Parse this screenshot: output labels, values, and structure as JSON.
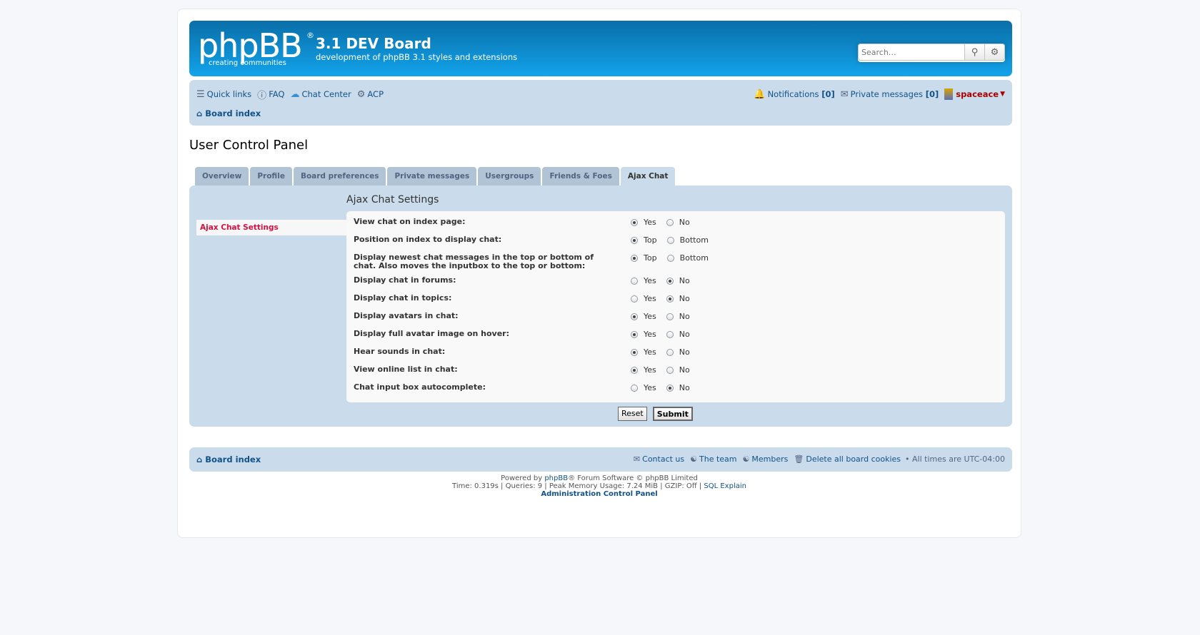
{
  "header": {
    "logo_text": "phpBB",
    "logo_reg": "®",
    "logo_sub": "creating   communities",
    "site_title": "3.1 DEV Board",
    "site_desc": "development of phpBB 3.1 styles and extensions",
    "search_placeholder": "Search…"
  },
  "nav": {
    "quick_links": "Quick links",
    "faq": "FAQ",
    "chat_center": "Chat Center",
    "acp": "ACP",
    "notifications": "Notifications",
    "notifications_count": "[0]",
    "private_messages": "Private messages",
    "pm_count": "[0]",
    "username": "spaceace",
    "breadcrumb": "Board index"
  },
  "page_title": "User Control Panel",
  "tabs": [
    {
      "label": "Overview"
    },
    {
      "label": "Profile"
    },
    {
      "label": "Board preferences"
    },
    {
      "label": "Private messages"
    },
    {
      "label": "Usergroups"
    },
    {
      "label": "Friends & Foes"
    },
    {
      "label": "Ajax Chat"
    }
  ],
  "sidenav": {
    "item": "Ajax Chat Settings"
  },
  "content": {
    "heading": "Ajax Chat Settings",
    "rows": [
      {
        "label": "View chat on index page:",
        "opt1": "Yes",
        "opt2": "No",
        "selected": 1
      },
      {
        "label": "Position on index to display chat:",
        "opt1": "Top",
        "opt2": "Bottom",
        "selected": 1
      },
      {
        "label": "Display newest chat messages in the top or bottom of chat. Also moves the inputbox to the top or bottom:",
        "opt1": "Top",
        "opt2": "Bottom",
        "selected": 1
      },
      {
        "label": "Display chat in forums:",
        "opt1": "Yes",
        "opt2": "No",
        "selected": 2
      },
      {
        "label": "Display chat in topics:",
        "opt1": "Yes",
        "opt2": "No",
        "selected": 2
      },
      {
        "label": "Display avatars in chat:",
        "opt1": "Yes",
        "opt2": "No",
        "selected": 1
      },
      {
        "label": "Display full avatar image on hover:",
        "opt1": "Yes",
        "opt2": "No",
        "selected": 1
      },
      {
        "label": "Hear sounds in chat:",
        "opt1": "Yes",
        "opt2": "No",
        "selected": 1
      },
      {
        "label": "View online list in chat:",
        "opt1": "Yes",
        "opt2": "No",
        "selected": 1
      },
      {
        "label": "Chat input box autocomplete:",
        "opt1": "Yes",
        "opt2": "No",
        "selected": 2
      }
    ],
    "reset_label": "Reset",
    "submit_label": "Submit"
  },
  "footer": {
    "breadcrumb": "Board index",
    "contact": "Contact us",
    "team": "The team",
    "members": "Members",
    "delete_cookies": "Delete all board cookies",
    "timezone": "• All times are UTC-04:00",
    "powered_prefix": "Powered by",
    "powered_link": "phpBB",
    "powered_suffix": "® Forum Software © phpBB Limited",
    "stats": "Time: 0.319s | Queries: 9 | Peak Memory Usage: 7.24 MiB | GZIP: Off |",
    "sql_explain": "SQL Explain",
    "acp_link": "Administration Control Panel"
  }
}
